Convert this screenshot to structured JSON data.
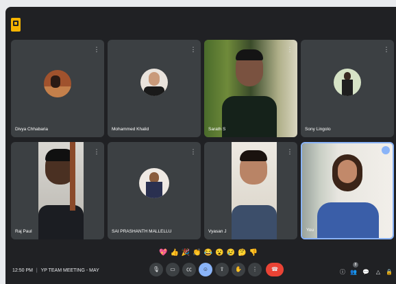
{
  "participants": [
    {
      "name": "Divya Chhabaria",
      "type": "avatar"
    },
    {
      "name": "Mohammed Khalid",
      "type": "avatar"
    },
    {
      "name": "Sarath S",
      "type": "video"
    },
    {
      "name": "Sony Lingolo",
      "type": "avatar"
    },
    {
      "name": "Raj Paul",
      "type": "video"
    },
    {
      "name": "SAI PRASHANTH MALLELLU",
      "type": "avatar"
    },
    {
      "name": "Vyasan J",
      "type": "video"
    },
    {
      "name": "You",
      "type": "video",
      "active": true
    }
  ],
  "reactions": [
    "💖",
    "👍",
    "🎉",
    "👏",
    "😂",
    "😮",
    "😢",
    "🤔",
    "👎"
  ],
  "bottom_bar": {
    "time": "12:50 PM",
    "separator": "|",
    "meeting_title": "YP TEAM MEETING - MAY",
    "participant_badge": "8"
  },
  "colors": {
    "accent": "#8ab4f8",
    "end_call": "#ea4335",
    "notes": "#f6b400",
    "tile": "#3c4043",
    "background": "#202124"
  }
}
